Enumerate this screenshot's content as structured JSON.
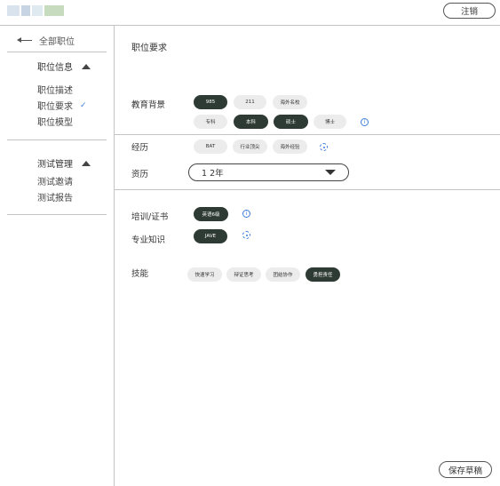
{
  "header": {
    "logout_label": "注销"
  },
  "sidebar": {
    "back_label": "全部职位",
    "groups": [
      {
        "title": "职位信息",
        "items": [
          {
            "label": "职位描述",
            "checked": false
          },
          {
            "label": "职位要求",
            "checked": true
          },
          {
            "label": "职位模型",
            "checked": false
          }
        ]
      },
      {
        "title": "测试管理",
        "items": [
          {
            "label": "测试邀请"
          },
          {
            "label": "测试报告"
          }
        ]
      }
    ],
    "check_mark": "✓"
  },
  "main": {
    "section_title": "职位要求",
    "education": {
      "label": "教育背景",
      "school_tags": [
        {
          "label": "985",
          "selected": true
        },
        {
          "label": "211",
          "selected": false
        },
        {
          "label": "海外名校",
          "selected": false
        }
      ],
      "degree_tags": [
        {
          "label": "专科",
          "selected": false
        },
        {
          "label": "本科",
          "selected": true
        },
        {
          "label": "硕士",
          "selected": true
        },
        {
          "label": "博士",
          "selected": false
        }
      ],
      "info_icon_text": "i"
    },
    "experience": {
      "label": "经历",
      "tags": [
        {
          "label": "BAT",
          "selected": false
        },
        {
          "label": "行业顶尖",
          "selected": false
        },
        {
          "label": "海外经验",
          "selected": false
        }
      ]
    },
    "seniority": {
      "label": "资历",
      "value": "1 2年"
    },
    "certificate": {
      "label": "培训/证书",
      "tags": [
        {
          "label": "英语6级",
          "selected": true
        }
      ],
      "info_icon_text": "i"
    },
    "knowledge": {
      "label": "专业知识",
      "tags": [
        {
          "label": "JAVE",
          "selected": true
        }
      ]
    },
    "skills": {
      "label": "技能",
      "tags": [
        {
          "label": "快速学习",
          "selected": false
        },
        {
          "label": "辩证思考",
          "selected": false
        },
        {
          "label": "团结协作",
          "selected": false
        },
        {
          "label": "勇担责任",
          "selected": true
        }
      ]
    },
    "save_label": "保存草稿"
  }
}
